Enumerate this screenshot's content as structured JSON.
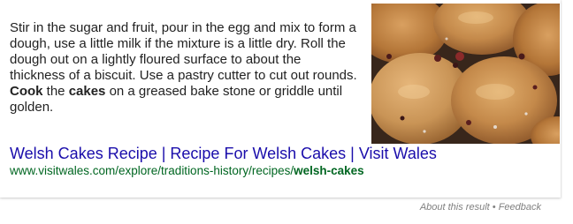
{
  "featured_snippet": {
    "text_parts": [
      "Stir in the sugar and fruit, pour in the egg and mix to form a dough, use a little milk if the mixture is a little dry. Roll the dough out on a lightly floured surface to about the thickness of a biscuit. Use a pastry cutter to cut out rounds. ",
      "Cook",
      " the ",
      "cakes",
      " on a greased bake stone or griddle until golden."
    ],
    "image": {
      "icon": "welsh-cakes-photo",
      "colors": [
        "#c58a4a",
        "#3a2a1c",
        "#7a3a2a"
      ]
    }
  },
  "result": {
    "title": "Welsh Cakes Recipe | Recipe For Welsh Cakes | Visit Wales",
    "url_prefix": "www.visitwales.com/explore/traditions-history/recipes/",
    "url_bold": "welsh-cakes",
    "title_color": "#1a0dab",
    "url_color": "#006621"
  },
  "footer": {
    "about_label": "About this result",
    "separator": "•",
    "feedback_label": "Feedback"
  }
}
